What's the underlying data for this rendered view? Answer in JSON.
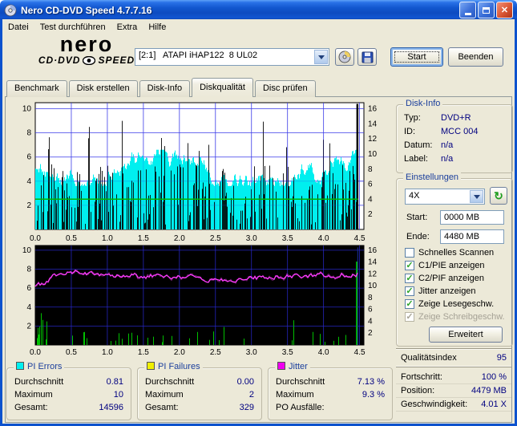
{
  "window": {
    "title": "Nero CD-DVD Speed 4.7.7.16"
  },
  "menu": {
    "items": [
      "Datei",
      "Test durchführen",
      "Extra",
      "Hilfe"
    ]
  },
  "logo": {
    "brand": "nero",
    "sub_left": "CD·DVD",
    "sub_right": "SPEED"
  },
  "toolbar": {
    "drive_selected": "[2:1]   ATAPI iHAP122  8 UL02",
    "start_label": "Start",
    "quit_label": "Beenden"
  },
  "tabs": [
    {
      "label": "Benchmark"
    },
    {
      "label": "Disk erstellen"
    },
    {
      "label": "Disk-Info"
    },
    {
      "label": "Diskqualität",
      "active": true
    },
    {
      "label": "Disc prüfen"
    }
  ],
  "disk_info": {
    "title": "Disk-Info",
    "rows": [
      {
        "label": "Typ:",
        "value": "DVD+R"
      },
      {
        "label": "ID:",
        "value": "MCC 004"
      },
      {
        "label": "Datum:",
        "value": "n/a"
      },
      {
        "label": "Label:",
        "value": "n/a"
      }
    ]
  },
  "settings": {
    "title": "Einstellungen",
    "speed_selected": "4X",
    "start_label": "Start:",
    "start_value": "0000 MB",
    "end_label": "Ende:",
    "end_value": "4480 MB",
    "checkboxes": [
      {
        "label": "Schnelles Scannen",
        "checked": false,
        "disabled": false
      },
      {
        "label": "C1/PIE anzeigen",
        "checked": true,
        "disabled": false
      },
      {
        "label": "C2/PIF anzeigen",
        "checked": true,
        "disabled": false
      },
      {
        "label": "Jitter anzeigen",
        "checked": true,
        "disabled": false
      },
      {
        "label": "Zeige Lesegeschw.",
        "checked": true,
        "disabled": false
      },
      {
        "label": "Zeige Schreibgeschw.",
        "checked": true,
        "disabled": true
      }
    ],
    "advanced_label": "Erweitert"
  },
  "quality": {
    "label": "Qualitätsindex",
    "value": "95"
  },
  "progress": {
    "rows": [
      {
        "label": "Fortschritt:",
        "value": "100 %"
      },
      {
        "label": "Position:",
        "value": "4479 MB"
      },
      {
        "label": "Geschwindigkeit:",
        "value": "4.01 X"
      }
    ]
  },
  "stats": [
    {
      "title": "PI Errors",
      "color": "#00F0F0",
      "rows": [
        {
          "label": "Durchschnitt",
          "value": "0.81"
        },
        {
          "label": "Maximum",
          "value": "10"
        },
        {
          "label": "Gesamt:",
          "value": "14596"
        }
      ]
    },
    {
      "title": "PI Failures",
      "color": "#F0F000",
      "rows": [
        {
          "label": "Durchschnitt",
          "value": "0.00"
        },
        {
          "label": "Maximum",
          "value": "2"
        },
        {
          "label": "Gesamt:",
          "value": "329"
        }
      ]
    },
    {
      "title": "Jitter",
      "color": "#F000F0",
      "rows": [
        {
          "label": "Durchschnitt",
          "value": "7.13 %"
        },
        {
          "label": "Maximum",
          "value": "9.3 %"
        },
        {
          "label": "PO Ausfälle:",
          "value": ""
        }
      ]
    }
  ],
  "chart_data": [
    {
      "type": "bar",
      "name": "pi-errors-and-read-speed",
      "x_ticks": [
        "0.0",
        "0.5",
        "1.0",
        "1.5",
        "2.0",
        "2.5",
        "3.0",
        "3.5",
        "4.0",
        "4.5"
      ],
      "x_data_end_gb": 4.48,
      "y_left": {
        "ticks": [
          10,
          8,
          6,
          4,
          2
        ],
        "max": 10.5
      },
      "y_right": {
        "ticks": [
          16,
          14,
          12,
          10,
          8,
          6,
          4,
          2
        ],
        "max": 16.8
      },
      "plot_bg": "#FFFFFF",
      "grid_color": "#3A3AE8",
      "series": [
        {
          "name": "PI Errors (C1/PIE)",
          "type": "bar",
          "color": "#00EFEF",
          "spike_color": "#000000",
          "average": 0.81,
          "maximum": 10,
          "total": 14596
        },
        {
          "name": "Lesegeschwindigkeit",
          "type": "line",
          "color": "#00B400",
          "value_x": 4.01,
          "axis": "right"
        }
      ],
      "seed": 20107
    },
    {
      "type": "mixed",
      "name": "jitter-and-pi-failures",
      "x_ticks": [
        "0.0",
        "0.5",
        "1.0",
        "1.5",
        "2.0",
        "2.5",
        "3.0",
        "3.5",
        "4.0",
        "4.5"
      ],
      "x_data_end_gb": 4.48,
      "y_left": {
        "ticks": [
          10,
          8,
          6,
          4,
          2
        ],
        "max": 10.5
      },
      "y_right": {
        "ticks": [
          16,
          14,
          12,
          10,
          8,
          6,
          4,
          2
        ],
        "max": 16.8
      },
      "plot_bg": "#000000",
      "grid_color": "#2828C8",
      "series": [
        {
          "name": "PI Failures (C2/PIF)",
          "type": "bar",
          "color": "#00C000",
          "average": 0.0,
          "maximum": 2,
          "total": 329
        },
        {
          "name": "Jitter",
          "type": "line",
          "color": "#FF3CFF",
          "average_pct": 7.13,
          "maximum_pct": 9.3
        }
      ],
      "seed": 4117
    }
  ]
}
